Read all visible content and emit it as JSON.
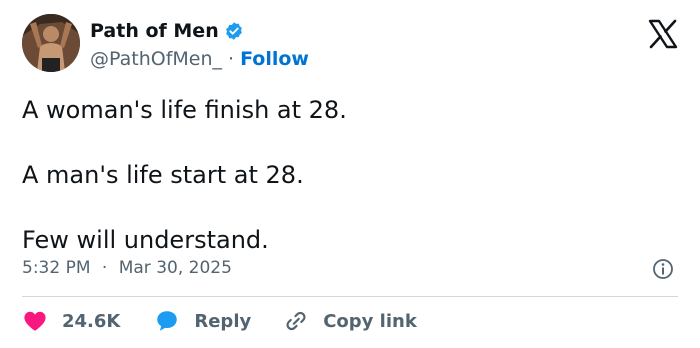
{
  "author": {
    "name": "Path of Men",
    "handle": "@PathOfMen_",
    "separator": "·",
    "follow_label": "Follow"
  },
  "tweet": {
    "lines": [
      "A woman's life finish at 28.",
      "A man's life start at 28.",
      "Few will understand."
    ]
  },
  "meta": {
    "time": "5:32 PM",
    "separator": "·",
    "date": "Mar 30, 2025"
  },
  "actions": {
    "likes": "24.6K",
    "reply_label": "Reply",
    "copy_label": "Copy link"
  },
  "icons": {
    "verified": "verified-badge-icon",
    "x_logo": "x-logo-icon",
    "info": "info-icon",
    "heart": "heart-icon",
    "reply": "speech-bubble-icon",
    "link": "link-icon"
  },
  "colors": {
    "text": "#0f1419",
    "secondary": "#536471",
    "link": "#0074d4",
    "verified": "#1d9bf0",
    "like": "#f91880",
    "reply": "#1d9bf0",
    "divider": "#cfd9de"
  }
}
